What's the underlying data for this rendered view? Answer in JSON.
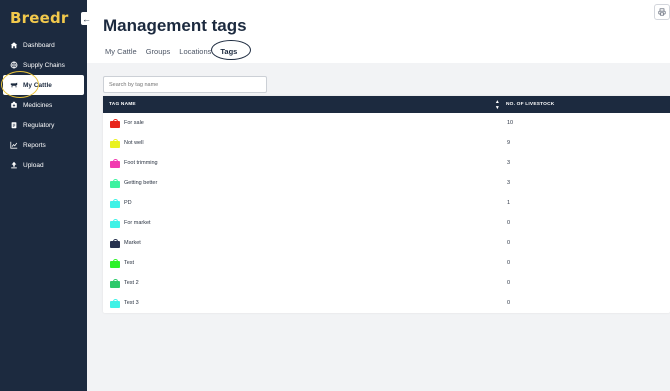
{
  "brand": {
    "logo_text": "Breedr",
    "logo_color": "#f2c94c"
  },
  "sidebar": {
    "items": [
      {
        "label": "Dashboard",
        "icon": "home-icon"
      },
      {
        "label": "Supply Chains",
        "icon": "globe-icon"
      },
      {
        "label": "My Cattle",
        "icon": "cow-icon"
      },
      {
        "label": "Medicines",
        "icon": "medicine-icon"
      },
      {
        "label": "Regulatory",
        "icon": "clipboard-icon"
      },
      {
        "label": "Reports",
        "icon": "chart-icon"
      },
      {
        "label": "Upload",
        "icon": "upload-icon"
      }
    ],
    "active_index": 2
  },
  "page": {
    "title": "Management tags",
    "tabs": [
      "My Cattle",
      "Groups",
      "Locations",
      "Tags"
    ],
    "active_tab": "Tags"
  },
  "search": {
    "placeholder": "Search by tag name"
  },
  "table": {
    "columns": [
      "TAG NAME",
      "NO. OF LIVESTOCK"
    ],
    "rows": [
      {
        "name": "For sale",
        "count": "10",
        "color": "#e8251c"
      },
      {
        "name": "Not well",
        "count": "9",
        "color": "#e9f220"
      },
      {
        "name": "Foot trimming",
        "count": "3",
        "color": "#f23bb0"
      },
      {
        "name": "Getting better",
        "count": "3",
        "color": "#3df2a0"
      },
      {
        "name": "PD",
        "count": "1",
        "color": "#3ff2e6"
      },
      {
        "name": "For market",
        "count": "0",
        "color": "#3ff2e6"
      },
      {
        "name": "Market",
        "count": "0",
        "color": "#27324f"
      },
      {
        "name": "Test",
        "count": "0",
        "color": "#2df22a"
      },
      {
        "name": "Test 2",
        "count": "0",
        "color": "#2cc96a"
      },
      {
        "name": "Test 3",
        "count": "0",
        "color": "#3ff2e6"
      }
    ]
  },
  "colors": {
    "sidebar_bg": "#1c2a3f",
    "highlight_ring": "#e9c43c"
  }
}
